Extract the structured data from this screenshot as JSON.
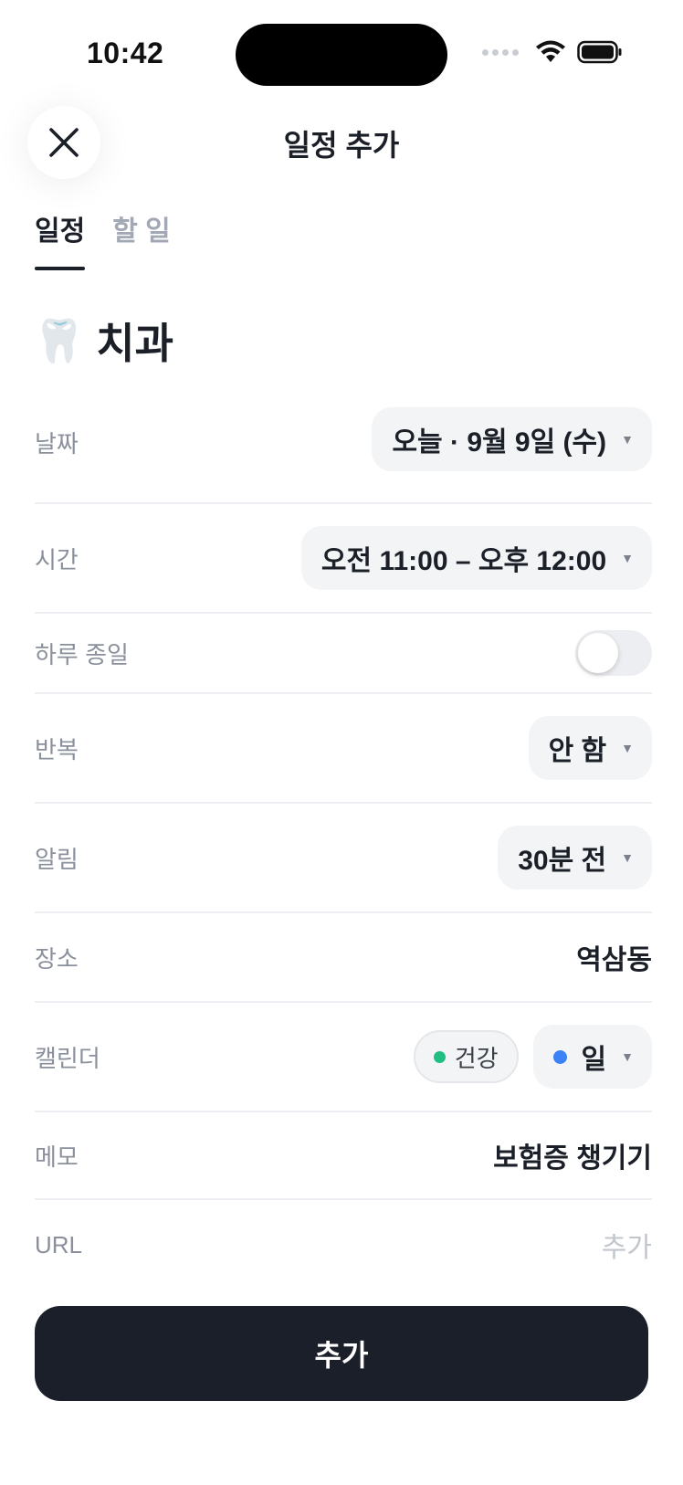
{
  "status_bar": {
    "time": "10:42"
  },
  "header": {
    "title": "일정 추가"
  },
  "tabs": [
    {
      "label": "일정",
      "active": true
    },
    {
      "label": "할 일",
      "active": false
    }
  ],
  "event": {
    "emoji": "🦷",
    "title": "치과"
  },
  "fields": {
    "date": {
      "label": "날짜",
      "value": "오늘 · 9월 9일 (수)"
    },
    "time": {
      "label": "시간",
      "value": "오전 11:00 – 오후 12:00"
    },
    "all_day": {
      "label": "하루 종일",
      "on": false
    },
    "repeat": {
      "label": "반복",
      "value": "안 함"
    },
    "alert": {
      "label": "알림",
      "value": "30분 전"
    },
    "location": {
      "label": "장소",
      "value": "역삼동"
    },
    "calendar": {
      "label": "캘린더",
      "chip_label": "건강",
      "chip_color": "#1fbf83",
      "selected": "일",
      "selected_color": "#3b82f6"
    },
    "memo": {
      "label": "메모",
      "value": "보험증 챙기기"
    },
    "url": {
      "label": "URL",
      "placeholder": "추가"
    }
  },
  "cta": {
    "label": "추가"
  },
  "colors": {
    "primary": "#1b1f2a",
    "muted": "#8a909b",
    "pill_bg": "#f3f4f6"
  }
}
